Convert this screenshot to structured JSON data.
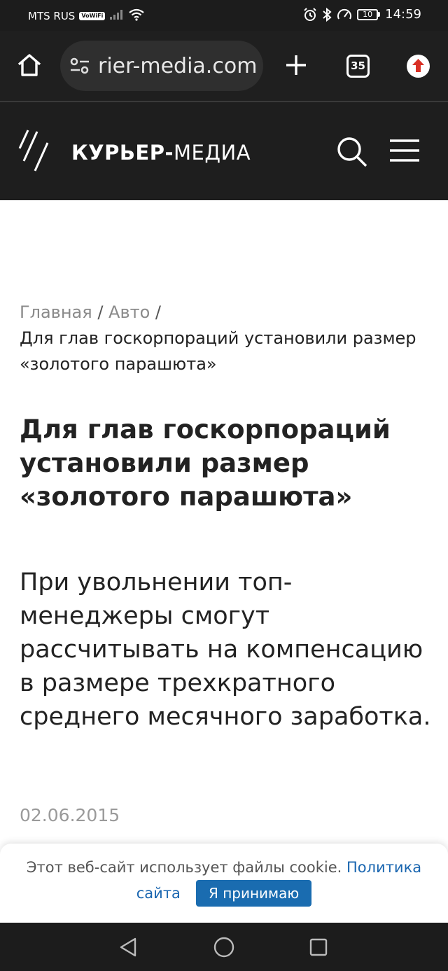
{
  "status_bar": {
    "carrier": "MTS RUS",
    "vowifi": "VoWiFi",
    "battery": "10",
    "time": "14:59"
  },
  "browser": {
    "url": "rier-media.com",
    "tab_count": "35"
  },
  "site": {
    "logo_bold": "КУРЬЕР-",
    "logo_regular": "МЕДИА"
  },
  "breadcrumb": {
    "home": "Главная",
    "separator": "/",
    "section": "Авто",
    "current": "Для глав госкорпораций установили размер «золотого парашюта»"
  },
  "article": {
    "title": "Для глав госкорпораций установили размер «золотого парашюта»",
    "lead": "При увольнении топ-менеджеры смогут рассчитывать на компенсацию в размере трехкратного среднего месячного заработка.",
    "date": "02.06.2015"
  },
  "cookie_banner": {
    "text": "Этот веб-сайт использует файлы cookie.",
    "policy_link_part1": "Политика",
    "policy_link_part2": "сайта",
    "accept_label": "Я принимаю"
  }
}
